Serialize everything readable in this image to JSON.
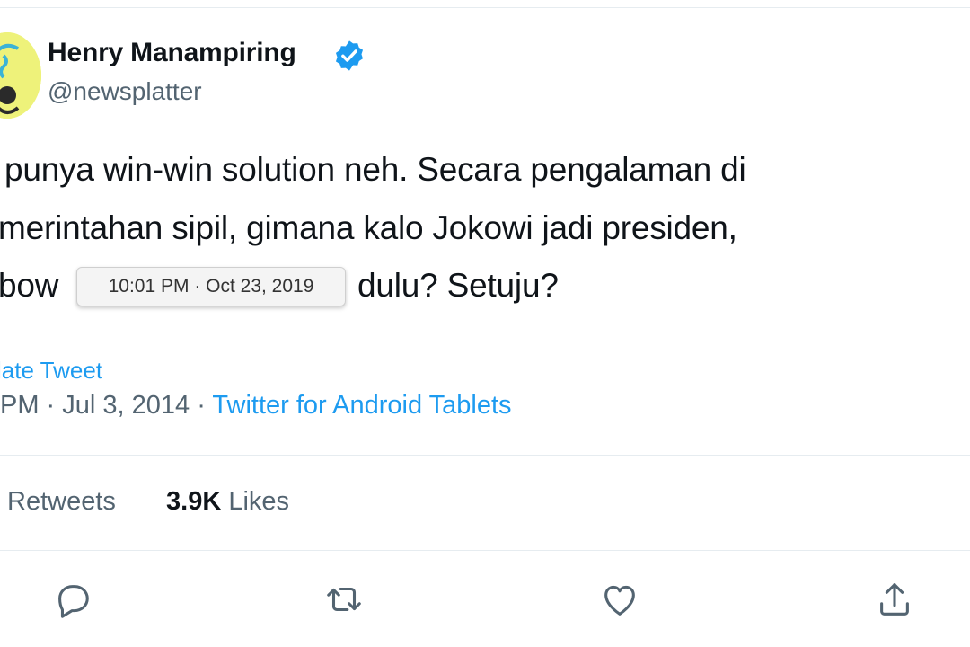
{
  "author": {
    "name": "Henry Manampiring",
    "handle": "@newsplatter",
    "verified": true
  },
  "tweet": {
    "line1": "punya win-win solution neh. Secara pengalaman di",
    "line2": "merintahan sipil, gimana kalo Jokowi jadi presiden,",
    "line3_start": "bow",
    "line3_end": "dulu? Setuju?"
  },
  "tooltip": "10:01 PM · Oct 23, 2019",
  "translate_label": "late Tweet",
  "meta": {
    "time": "PM · Jul 3, 2014 · ",
    "source": "Twitter for Android Tablets"
  },
  "stats": {
    "retweets_label": "Retweets",
    "likes_count": "3.9K",
    "likes_label": "Likes"
  },
  "icons": [
    "reply-icon",
    "retweet-icon",
    "like-icon",
    "share-icon"
  ],
  "colors": {
    "accent": "#1d9bf0",
    "secondary_text": "#536471",
    "primary_text": "#0f1419"
  }
}
